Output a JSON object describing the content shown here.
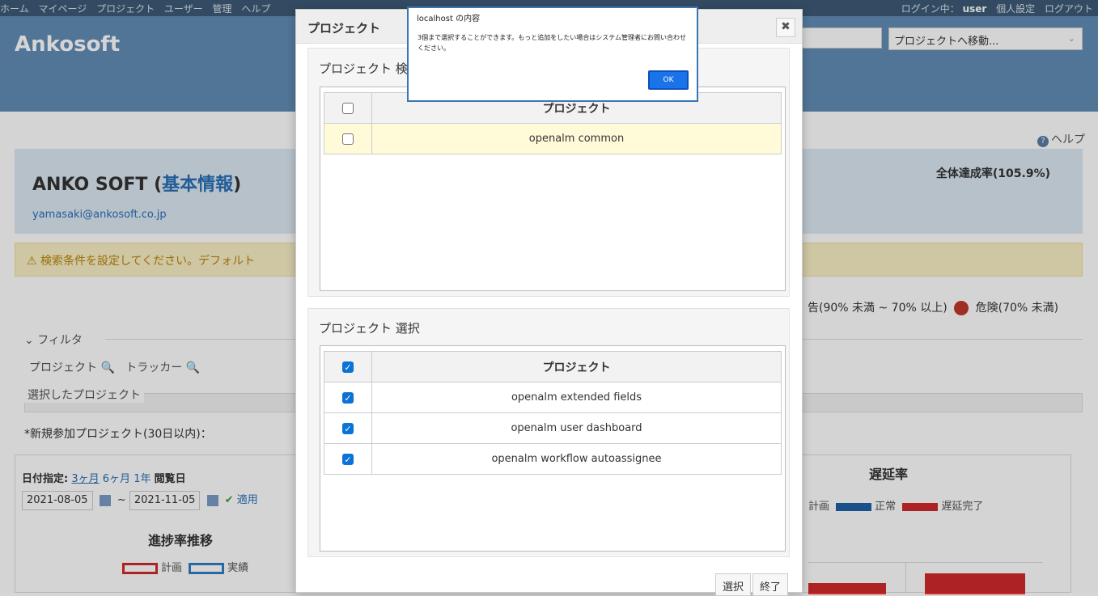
{
  "top_menu": {
    "items": [
      "ホーム",
      "マイページ",
      "プロジェクト",
      "ユーザー",
      "管理",
      "ヘルプ"
    ],
    "login_label": "ログイン中：",
    "user": "user",
    "personal_settings": "個人設定",
    "logout": "ログアウト"
  },
  "header": {
    "app_title": "Ankosoft",
    "project_jump": "プロジェクトへ移動..."
  },
  "content": {
    "help_link": "ヘルプ",
    "org_name_prefix": "ANKO SOFT (",
    "org_name_link": "基本情報",
    "org_name_suffix": ")",
    "org_email": "yamasaki@ankosoft.co.jp",
    "overall_rate": "全体達成率(105.9%)",
    "warning_text": "検索条件を設定してください。デフォルト",
    "legend_right": "告(90% 未満 ~ 70% 以上)",
    "legend_danger": "危険(70% 未満)",
    "filter_title": "フィルタ",
    "filter_project": "プロジェクト",
    "filter_tracker": "トラッカー",
    "selected_projects": "選択したプロジェクト",
    "new_projects": "*新規参加プロジェクト(30日以内)：",
    "date_label": "日付指定:",
    "date_3m": "3ヶ月",
    "date_6m": "6ヶ月",
    "date_1y": "1年",
    "date_view": "閲覧日",
    "date_from": "2021-08-05",
    "date_sep": "~",
    "date_to": "2021-11-05",
    "apply": "適用",
    "progress_chart_title": "進捗率推移",
    "legend_plan": "計画",
    "legend_actual": "実績",
    "delay_chart_title": "遅延率",
    "legend_plan2": "計画",
    "legend_normal": "正常",
    "legend_delay": "遅延完了"
  },
  "modal": {
    "title": "プロジェクト",
    "search_section_title": "プロジェクト 検",
    "search_table": {
      "header": "プロジェクト",
      "rows": [
        "openalm common"
      ]
    },
    "select_section_title": "プロジェクト 選択",
    "select_table": {
      "header": "プロジェクト",
      "rows": [
        "openalm extended fields",
        "openalm user dashboard",
        "openalm workflow autoassignee"
      ]
    },
    "select_button": "選択",
    "close_button": "終了"
  },
  "alert": {
    "title": "localhost の内容",
    "message": "3個まで選択することができます。もっと追加をしたい場合はシステム管理者にお問い合わせください。",
    "ok": "OK"
  },
  "colors": {
    "header_bg": "#628db6",
    "top_menu_bg": "#3e5b76",
    "plan": "#d0292b",
    "actual": "#2f7fc1",
    "normal": "#1f5fa8",
    "delay": "#d0292b",
    "checkbox_on": "#0b72d6",
    "alert_ok": "#1a73e8"
  }
}
